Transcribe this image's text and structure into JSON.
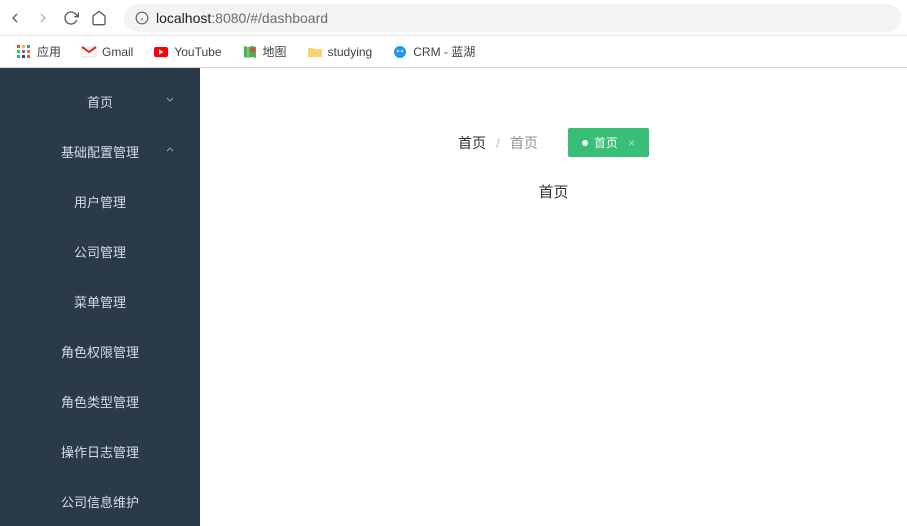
{
  "browser": {
    "host": "localhost",
    "port": ":8080",
    "path": "/#/dashboard"
  },
  "bookmarks": {
    "apps": "应用",
    "gmail": "Gmail",
    "youtube": "YouTube",
    "maps": "地图",
    "studying": "studying",
    "crm": "CRM - 蓝湖"
  },
  "sidebar": {
    "items": [
      {
        "label": "首页"
      },
      {
        "label": "基础配置管理"
      },
      {
        "label": "用户管理"
      },
      {
        "label": "公司管理"
      },
      {
        "label": "菜单管理"
      },
      {
        "label": "角色权限管理"
      },
      {
        "label": "角色类型管理"
      },
      {
        "label": "操作日志管理"
      },
      {
        "label": "公司信息维护"
      }
    ]
  },
  "breadcrumb": {
    "current": "首页",
    "separator": "/",
    "link": "首页"
  },
  "tag": {
    "label": "首页",
    "close": "×"
  },
  "page": {
    "title": "首页"
  }
}
